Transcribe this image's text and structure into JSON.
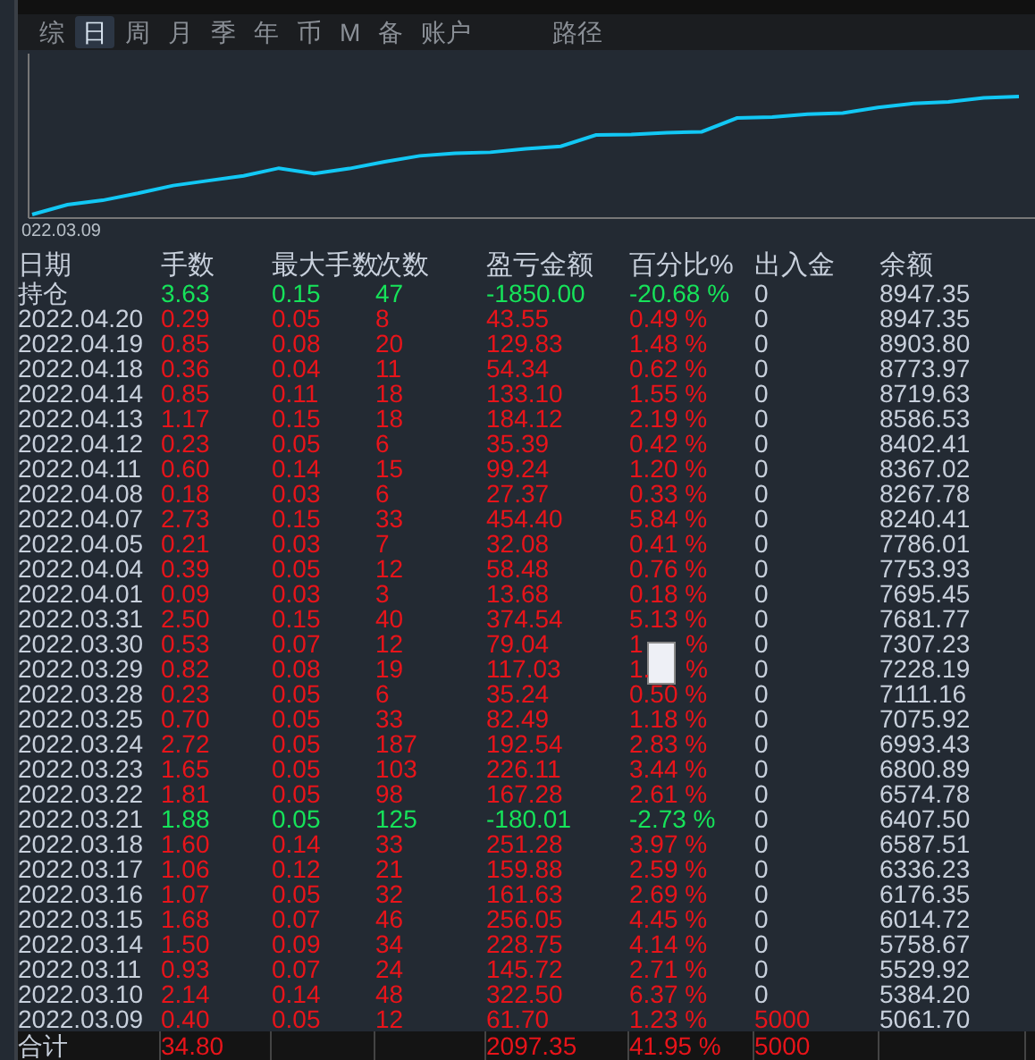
{
  "tabs": [
    {
      "label": "综",
      "selected": false
    },
    {
      "label": "日",
      "selected": true
    },
    {
      "label": "周",
      "selected": false
    },
    {
      "label": "月",
      "selected": false
    },
    {
      "label": "季",
      "selected": false
    },
    {
      "label": "年",
      "selected": false
    },
    {
      "label": "币",
      "selected": false
    },
    {
      "label": "M",
      "selected": false
    },
    {
      "label": "备",
      "selected": false
    },
    {
      "label": "账户",
      "selected": false
    }
  ],
  "path_tab": {
    "label": "路径",
    "selected": false
  },
  "chart": {
    "x_label": "022.03.09"
  },
  "table": {
    "columns": [
      "日期",
      "手数",
      "最大手数",
      "次数",
      "盈亏金额",
      "百分比%",
      "出入金",
      "余额"
    ],
    "rows": [
      {
        "date": "持仓",
        "lots": "3.63",
        "max": "0.15",
        "count": "47",
        "pnl": "-1850.00",
        "pct": "-20.68 %",
        "flow": "0",
        "balance": "8947.35",
        "loss": true,
        "flow_highlight": false
      },
      {
        "date": "2022.04.20",
        "lots": "0.29",
        "max": "0.05",
        "count": "8",
        "pnl": "43.55",
        "pct": "0.49 %",
        "flow": "0",
        "balance": "8947.35",
        "loss": false,
        "flow_highlight": false
      },
      {
        "date": "2022.04.19",
        "lots": "0.85",
        "max": "0.08",
        "count": "20",
        "pnl": "129.83",
        "pct": "1.48 %",
        "flow": "0",
        "balance": "8903.80",
        "loss": false,
        "flow_highlight": false
      },
      {
        "date": "2022.04.18",
        "lots": "0.36",
        "max": "0.04",
        "count": "11",
        "pnl": "54.34",
        "pct": "0.62 %",
        "flow": "0",
        "balance": "8773.97",
        "loss": false,
        "flow_highlight": false
      },
      {
        "date": "2022.04.14",
        "lots": "0.85",
        "max": "0.11",
        "count": "18",
        "pnl": "133.10",
        "pct": "1.55 %",
        "flow": "0",
        "balance": "8719.63",
        "loss": false,
        "flow_highlight": false
      },
      {
        "date": "2022.04.13",
        "lots": "1.17",
        "max": "0.15",
        "count": "18",
        "pnl": "184.12",
        "pct": "2.19 %",
        "flow": "0",
        "balance": "8586.53",
        "loss": false,
        "flow_highlight": false
      },
      {
        "date": "2022.04.12",
        "lots": "0.23",
        "max": "0.05",
        "count": "6",
        "pnl": "35.39",
        "pct": "0.42 %",
        "flow": "0",
        "balance": "8402.41",
        "loss": false,
        "flow_highlight": false
      },
      {
        "date": "2022.04.11",
        "lots": "0.60",
        "max": "0.14",
        "count": "15",
        "pnl": "99.24",
        "pct": "1.20 %",
        "flow": "0",
        "balance": "8367.02",
        "loss": false,
        "flow_highlight": false
      },
      {
        "date": "2022.04.08",
        "lots": "0.18",
        "max": "0.03",
        "count": "6",
        "pnl": "27.37",
        "pct": "0.33 %",
        "flow": "0",
        "balance": "8267.78",
        "loss": false,
        "flow_highlight": false
      },
      {
        "date": "2022.04.07",
        "lots": "2.73",
        "max": "0.15",
        "count": "33",
        "pnl": "454.40",
        "pct": "5.84 %",
        "flow": "0",
        "balance": "8240.41",
        "loss": false,
        "flow_highlight": false
      },
      {
        "date": "2022.04.05",
        "lots": "0.21",
        "max": "0.03",
        "count": "7",
        "pnl": "32.08",
        "pct": "0.41 %",
        "flow": "0",
        "balance": "7786.01",
        "loss": false,
        "flow_highlight": false
      },
      {
        "date": "2022.04.04",
        "lots": "0.39",
        "max": "0.05",
        "count": "12",
        "pnl": "58.48",
        "pct": "0.76 %",
        "flow": "0",
        "balance": "7753.93",
        "loss": false,
        "flow_highlight": false
      },
      {
        "date": "2022.04.01",
        "lots": "0.09",
        "max": "0.03",
        "count": "3",
        "pnl": "13.68",
        "pct": "0.18 %",
        "flow": "0",
        "balance": "7695.45",
        "loss": false,
        "flow_highlight": false
      },
      {
        "date": "2022.03.31",
        "lots": "2.50",
        "max": "0.15",
        "count": "40",
        "pnl": "374.54",
        "pct": "5.13 %",
        "flow": "0",
        "balance": "7681.77",
        "loss": false,
        "flow_highlight": false
      },
      {
        "date": "2022.03.30",
        "lots": "0.53",
        "max": "0.07",
        "count": "12",
        "pnl": "79.04",
        "pct": "1",
        "pct_tail": "%",
        "flow": "0",
        "balance": "7307.23",
        "loss": false,
        "flow_highlight": false
      },
      {
        "date": "2022.03.29",
        "lots": "0.82",
        "max": "0.08",
        "count": "19",
        "pnl": "117.03",
        "pct": "1.",
        "pct_tail": "%",
        "flow": "0",
        "balance": "7228.19",
        "loss": false,
        "flow_highlight": false
      },
      {
        "date": "2022.03.28",
        "lots": "0.23",
        "max": "0.05",
        "count": "6",
        "pnl": "35.24",
        "pct": "0.50 %",
        "flow": "0",
        "balance": "7111.16",
        "loss": false,
        "flow_highlight": false
      },
      {
        "date": "2022.03.25",
        "lots": "0.70",
        "max": "0.05",
        "count": "33",
        "pnl": "82.49",
        "pct": "1.18 %",
        "flow": "0",
        "balance": "7075.92",
        "loss": false,
        "flow_highlight": false
      },
      {
        "date": "2022.03.24",
        "lots": "2.72",
        "max": "0.05",
        "count": "187",
        "pnl": "192.54",
        "pct": "2.83 %",
        "flow": "0",
        "balance": "6993.43",
        "loss": false,
        "flow_highlight": false
      },
      {
        "date": "2022.03.23",
        "lots": "1.65",
        "max": "0.05",
        "count": "103",
        "pnl": "226.11",
        "pct": "3.44 %",
        "flow": "0",
        "balance": "6800.89",
        "loss": false,
        "flow_highlight": false
      },
      {
        "date": "2022.03.22",
        "lots": "1.81",
        "max": "0.05",
        "count": "98",
        "pnl": "167.28",
        "pct": "2.61 %",
        "flow": "0",
        "balance": "6574.78",
        "loss": false,
        "flow_highlight": false
      },
      {
        "date": "2022.03.21",
        "lots": "1.88",
        "max": "0.05",
        "count": "125",
        "pnl": "-180.01",
        "pct": "-2.73 %",
        "flow": "0",
        "balance": "6407.50",
        "loss": true,
        "flow_highlight": false
      },
      {
        "date": "2022.03.18",
        "lots": "1.60",
        "max": "0.14",
        "count": "33",
        "pnl": "251.28",
        "pct": "3.97 %",
        "flow": "0",
        "balance": "6587.51",
        "loss": false,
        "flow_highlight": false
      },
      {
        "date": "2022.03.17",
        "lots": "1.06",
        "max": "0.12",
        "count": "21",
        "pnl": "159.88",
        "pct": "2.59 %",
        "flow": "0",
        "balance": "6336.23",
        "loss": false,
        "flow_highlight": false
      },
      {
        "date": "2022.03.16",
        "lots": "1.07",
        "max": "0.05",
        "count": "32",
        "pnl": "161.63",
        "pct": "2.69 %",
        "flow": "0",
        "balance": "6176.35",
        "loss": false,
        "flow_highlight": false
      },
      {
        "date": "2022.03.15",
        "lots": "1.68",
        "max": "0.07",
        "count": "46",
        "pnl": "256.05",
        "pct": "4.45 %",
        "flow": "0",
        "balance": "6014.72",
        "loss": false,
        "flow_highlight": false
      },
      {
        "date": "2022.03.14",
        "lots": "1.50",
        "max": "0.09",
        "count": "34",
        "pnl": "228.75",
        "pct": "4.14 %",
        "flow": "0",
        "balance": "5758.67",
        "loss": false,
        "flow_highlight": false
      },
      {
        "date": "2022.03.11",
        "lots": "0.93",
        "max": "0.07",
        "count": "24",
        "pnl": "145.72",
        "pct": "2.71 %",
        "flow": "0",
        "balance": "5529.92",
        "loss": false,
        "flow_highlight": false
      },
      {
        "date": "2022.03.10",
        "lots": "2.14",
        "max": "0.14",
        "count": "48",
        "pnl": "322.50",
        "pct": "6.37 %",
        "flow": "0",
        "balance": "5384.20",
        "loss": false,
        "flow_highlight": false
      },
      {
        "date": "2022.03.09",
        "lots": "0.40",
        "max": "0.05",
        "count": "12",
        "pnl": "61.70",
        "pct": "1.23 %",
        "flow": "5000",
        "balance": "5061.70",
        "loss": false,
        "flow_highlight": true
      }
    ],
    "total": {
      "label": "合计",
      "lots": "34.80",
      "pnl": "2097.35",
      "pct": "41.95 %",
      "flow": "5000"
    }
  }
}
